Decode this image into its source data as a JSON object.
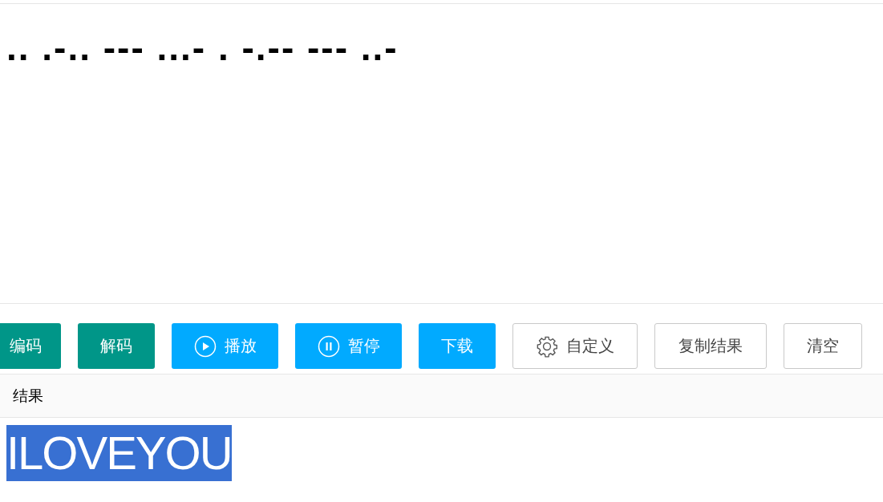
{
  "input": {
    "value": ".. .-.. --- ...- . -.-- --- ..-"
  },
  "buttons": [
    {
      "label": "编码",
      "kind": "primary"
    },
    {
      "label": "解码",
      "kind": "primary"
    },
    {
      "label": "播放",
      "kind": "info"
    },
    {
      "label": "暂停",
      "kind": "info"
    },
    {
      "label": "下载",
      "kind": "info"
    },
    {
      "label": "自定义",
      "kind": "default"
    },
    {
      "label": "复制结果",
      "kind": "default"
    },
    {
      "label": "清空",
      "kind": "default"
    }
  ],
  "result": {
    "heading": "结果",
    "value": "ILOVEYOU",
    "selected": true
  }
}
